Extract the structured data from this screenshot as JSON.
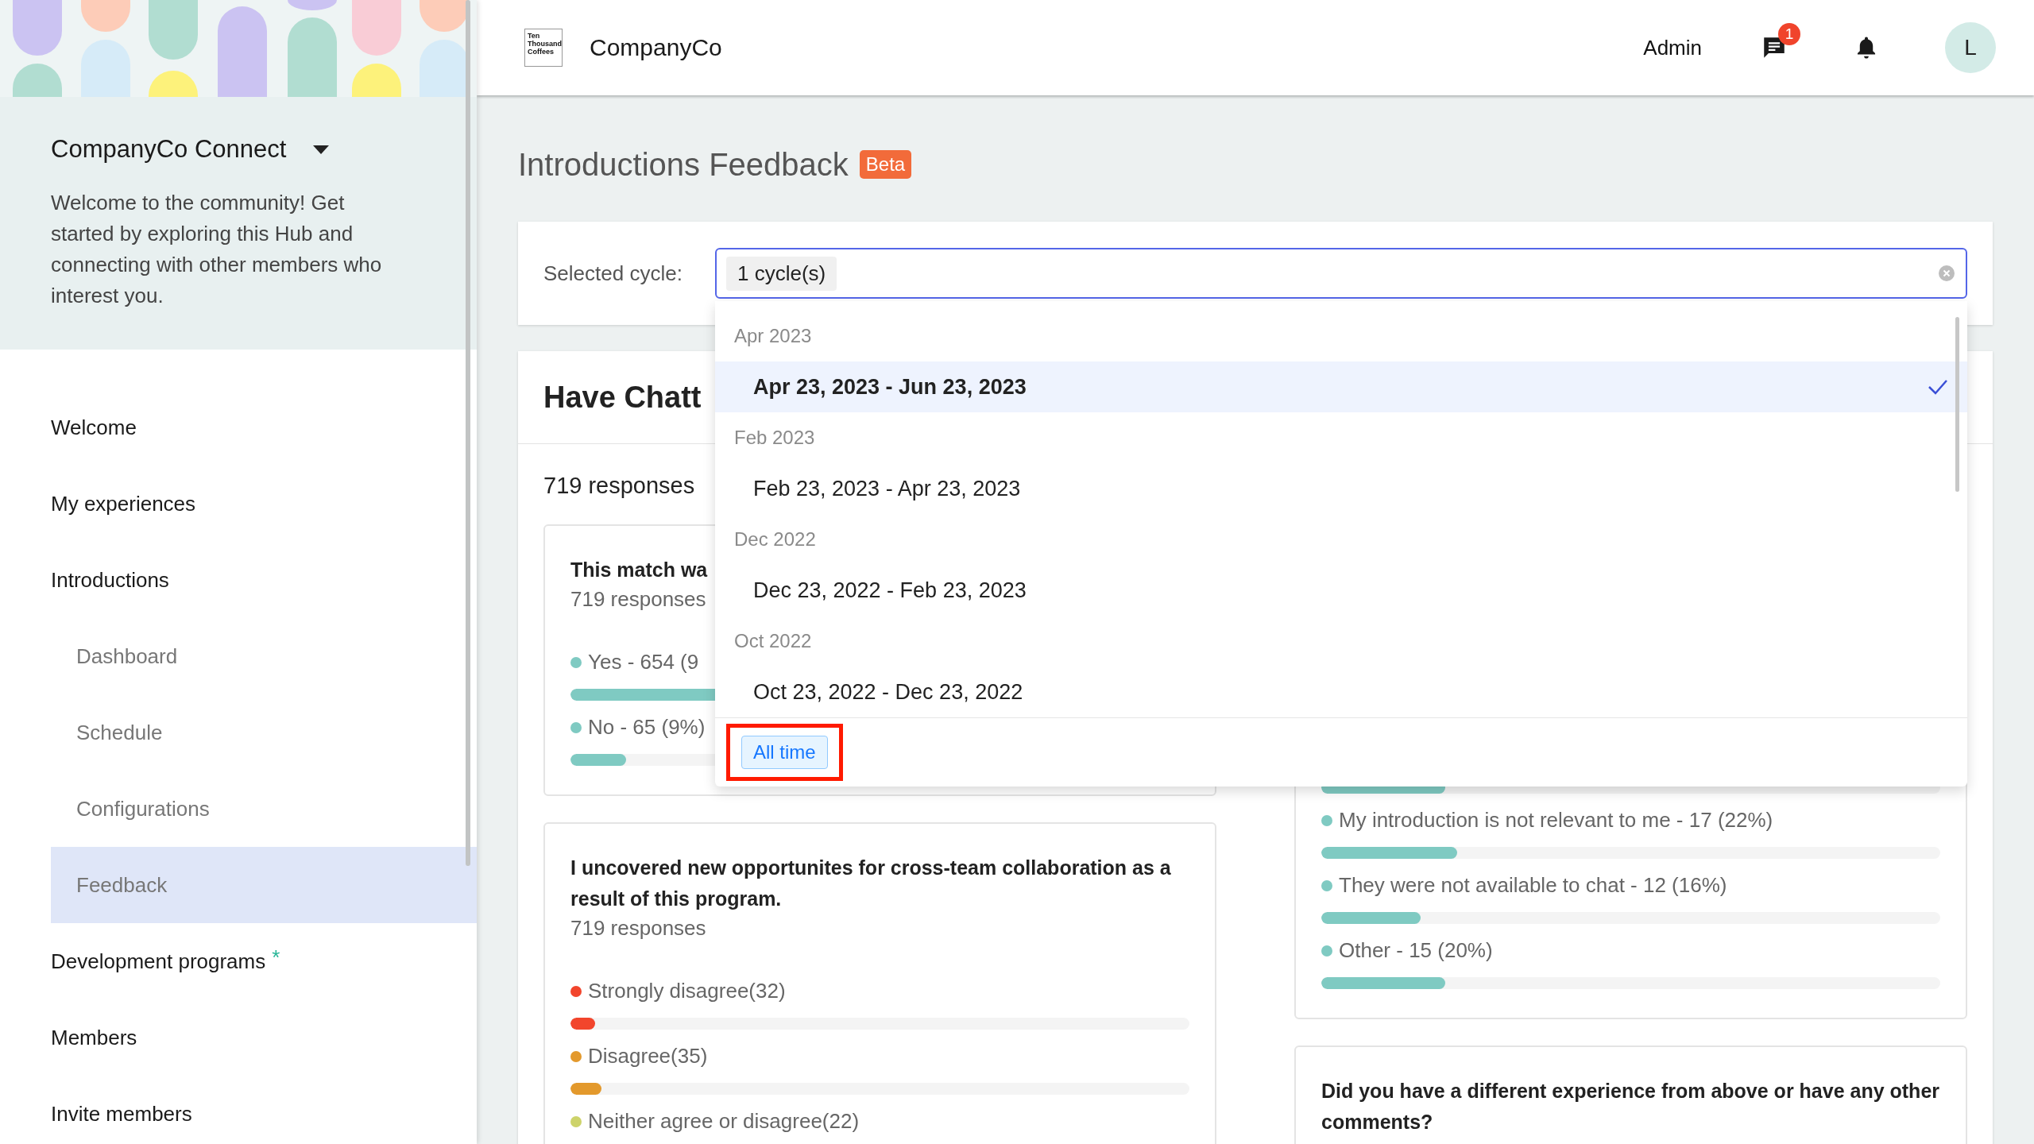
{
  "sidebar": {
    "hub_title": "CompanyCo Connect",
    "description": "Welcome to the community! Get started by exploring this Hub and connecting with other members who interest you.",
    "nav": [
      {
        "label": "Welcome",
        "selected": false
      },
      {
        "label": "My experiences",
        "selected": false
      },
      {
        "label": "Introductions",
        "selected": false,
        "children": [
          {
            "label": "Dashboard",
            "selected": false
          },
          {
            "label": "Schedule",
            "selected": false
          },
          {
            "label": "Configurations",
            "selected": false
          },
          {
            "label": "Feedback",
            "selected": true
          }
        ]
      },
      {
        "label": "Development programs",
        "selected": false,
        "marker": "*"
      },
      {
        "label": "Members",
        "selected": false
      },
      {
        "label": "Invite members",
        "selected": false
      }
    ]
  },
  "topbar": {
    "logo_text": "Ten Thousand Coffees",
    "company": "CompanyCo",
    "role": "Admin",
    "message_badge": "1",
    "avatar": "L"
  },
  "page": {
    "title": "Introductions Feedback",
    "badge": "Beta"
  },
  "filter": {
    "label": "Selected cycle:",
    "tag": "1 cycle(s)"
  },
  "dropdown": {
    "groups": [
      {
        "header": "Apr 2023",
        "options": [
          {
            "label": "Apr 23, 2023 - Jun 23, 2023",
            "selected": true
          }
        ]
      },
      {
        "header": "Feb 2023",
        "options": [
          {
            "label": "Feb 23, 2023 - Apr 23, 2023",
            "selected": false
          }
        ]
      },
      {
        "header": "Dec 2022",
        "options": [
          {
            "label": "Dec 23, 2022 - Feb 23, 2023",
            "selected": false
          }
        ]
      },
      {
        "header": "Oct 2022",
        "options": [
          {
            "label": "Oct 23, 2022 - Dec 23, 2022",
            "selected": false
          }
        ]
      }
    ],
    "footer_button": {
      "label": "All time",
      "highlighted": true
    }
  },
  "survey": {
    "title": "Have Chatt",
    "total": "719 responses",
    "left_cards": [
      {
        "question": "This match wa",
        "responses": "719 responses",
        "items": [
          {
            "label": "Yes - 654 (9",
            "color": "#7fcac2",
            "level": 0.91
          },
          {
            "label": "No - 65 (9%)",
            "color": "#7fcac2",
            "level": 0.09
          }
        ]
      },
      {
        "question": "I uncovered new opportunites for cross-team collaboration as a result of this program.",
        "responses": "719 responses",
        "items": [
          {
            "label": "Strongly disagree(32)",
            "color": "#f2452c",
            "level": 0.04
          },
          {
            "label": "Disagree(35)",
            "color": "#e3992c",
            "level": 0.05
          },
          {
            "label": "Neither agree or disagree(22)",
            "color": "#cdd36a"
          }
        ]
      }
    ],
    "right_cards": [
      {
        "items": [
          {
            "color": "#7fcac2",
            "level": 0.2
          },
          {
            "label": "My introduction is not relevant to me - 17 (22%)",
            "color": "#7fcac2",
            "level": 0.22
          },
          {
            "label": "They were not available to chat - 12 (16%)",
            "color": "#7fcac2",
            "level": 0.16
          },
          {
            "label": "Other - 15 (20%)",
            "color": "#7fcac2",
            "level": 0.2
          }
        ]
      },
      {
        "question": "Did you have a different experience from above or have any other comments?"
      }
    ]
  }
}
